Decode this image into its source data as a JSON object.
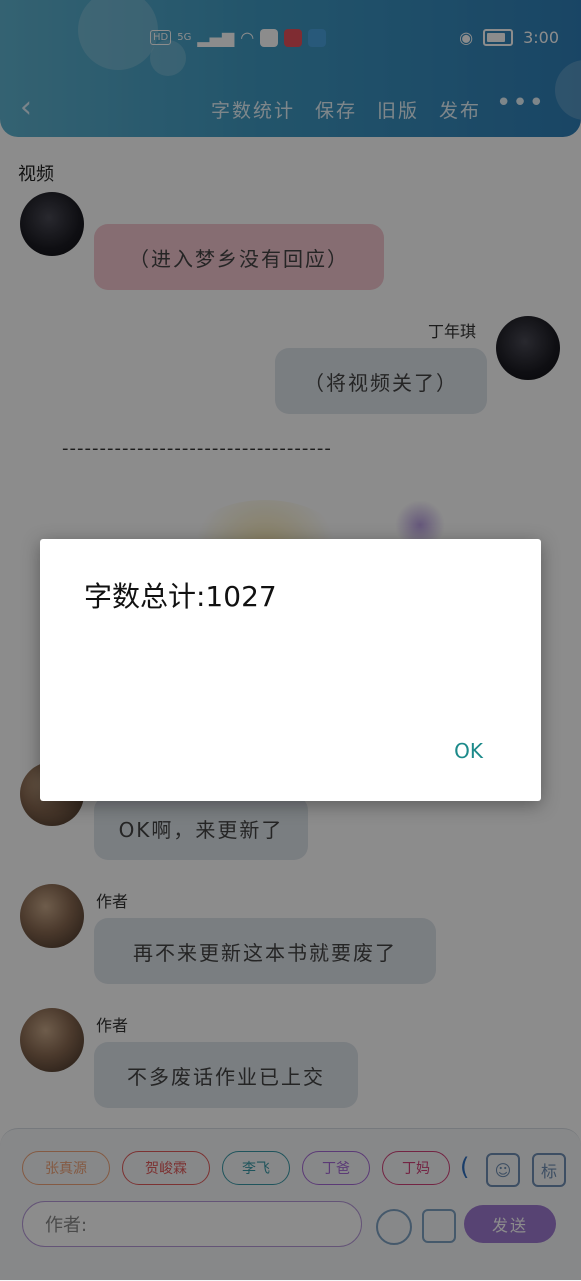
{
  "status": {
    "time": "3:00",
    "hd": "HD",
    "net": "5G"
  },
  "toolbar": {
    "items": [
      "字数统计",
      "保存",
      "旧版",
      "发布"
    ],
    "more": "•••",
    "back": "‹"
  },
  "section_label": "视频",
  "messages": [
    {
      "side": "left",
      "name": "",
      "text": "（进入梦乡没有回应）"
    },
    {
      "side": "right",
      "name": "丁年琪",
      "text": "（将视频关了）"
    },
    {
      "side": "left",
      "name": "",
      "text": "OK啊，来更新了"
    },
    {
      "side": "left",
      "name": "作者",
      "text": "再不来更新这本书就要废了"
    },
    {
      "side": "left",
      "name": "作者",
      "text": "不多废话作业已上交"
    }
  ],
  "divider": "------------------------------------",
  "dialog": {
    "message": "字数总计:1027",
    "ok_label": "OK"
  },
  "chips": [
    "张真源",
    "贺峻霖",
    "李飞",
    "丁爸",
    "丁妈"
  ],
  "input_placeholder": "作者:",
  "send_label": "发送",
  "colors": {
    "header": "#3f9ac3",
    "send": "#9f7ad1",
    "ok": "#1c8a8a"
  }
}
